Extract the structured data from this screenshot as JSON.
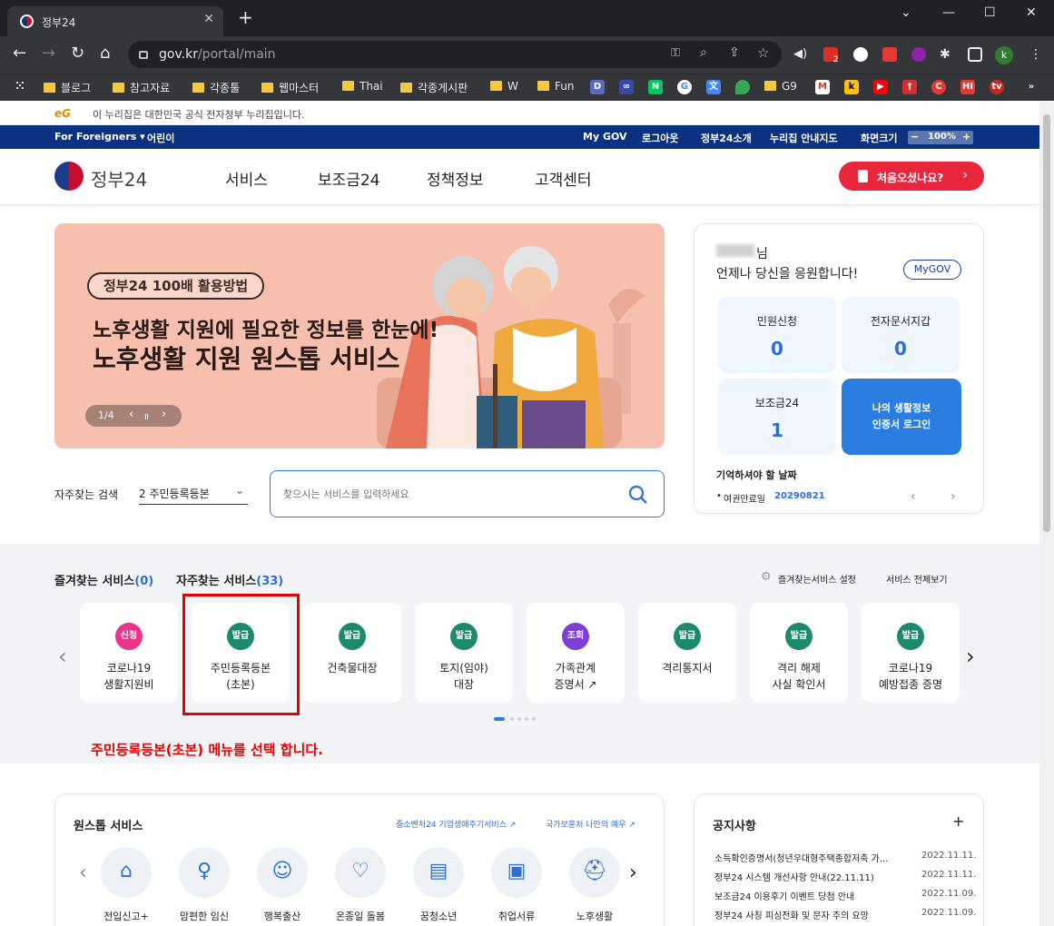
{
  "browser": {
    "tab_title": "정부24",
    "url_host": "gov.kr",
    "url_path": "/portal/main",
    "profile_initial": "k",
    "bookmarks": [
      "블로그",
      "참고자료",
      "각종툴",
      "웹마스터",
      "Thai",
      "각종게시판",
      "W",
      "Fun",
      "G9"
    ],
    "ext_badge": "2"
  },
  "notice_bar": {
    "logo": "eG",
    "text": "이 누리집은 대한민국 공식 전자정부 누리집입니다."
  },
  "gnb": {
    "for_foreigners": "For Foreigners ▾",
    "kids": "어린이",
    "mygov": "My GOV",
    "logout": "로그아웃",
    "about": "정부24소개",
    "sitemap": "누리집 안내지도",
    "screen_size": "화면크기",
    "zoom": "100%"
  },
  "header": {
    "logo": "정부24",
    "menu": [
      "서비스",
      "보조금24",
      "정책정보",
      "고객센터"
    ],
    "first_visit": "처음오셨나요?"
  },
  "banner": {
    "tag": "정부24 100배 활용방법",
    "line1": "노후생활 지원에 필요한 정보를 한눈에!",
    "line2": "노후생활 지원 원스톱 서비스",
    "pager": "1/4"
  },
  "user": {
    "suffix": "님",
    "greeting": "언제나 당신을 응원합니다!",
    "mygov_btn": "MyGOV",
    "tiles": [
      {
        "label": "민원신청",
        "value": "0"
      },
      {
        "label": "전자문서지갑",
        "value": "0"
      },
      {
        "label": "보조금24",
        "value": "1"
      }
    ],
    "login_tile": "나의 생활정보\n인증서 로그인",
    "remember_title": "기억하셔야 할 날짜",
    "remember_item": "여권만료일",
    "remember_date": "20290821"
  },
  "search": {
    "label": "자주찾는 검색",
    "selected": "2 주민등록등본",
    "placeholder": "찾으시는 서비스를 입력하세요"
  },
  "services": {
    "fav_title": "즐겨찾는 서비스",
    "fav_count": "(0)",
    "freq_title": "자주찾는 서비스",
    "freq_count": "(33)",
    "settings": "즐겨찾는서비스 설정",
    "view_all": "서비스 전체보기",
    "cards": [
      {
        "badge": "신청",
        "color": "#e8348b",
        "name": "코로나19\n생활지원비"
      },
      {
        "badge": "발급",
        "color": "#1d8a6e",
        "name": "주민등록등본\n(초본)"
      },
      {
        "badge": "발급",
        "color": "#1d8a6e",
        "name": "건축물대장"
      },
      {
        "badge": "발급",
        "color": "#1d8a6e",
        "name": "토지(임야)\n대장"
      },
      {
        "badge": "조회",
        "color": "#7b3fd6",
        "name": "가족관계\n증명서 ↗"
      },
      {
        "badge": "발급",
        "color": "#1d8a6e",
        "name": "격리통지서"
      },
      {
        "badge": "발급",
        "color": "#1d8a6e",
        "name": "격리 해제\n사실 확인서"
      },
      {
        "badge": "발급",
        "color": "#1d8a6e",
        "name": "코로나19\n예방접종 증명"
      }
    ],
    "annotation": "주민등록등본(초본) 메뉴를 선택 합니다."
  },
  "onestop": {
    "title": "원스톱 서비스",
    "link1": "중소벤처24 기업생애주기서비스 ↗",
    "link2": "국가보훈처 나만의 예우 ↗",
    "items": [
      "전입신고+",
      "맘편한 임신",
      "행복출산",
      "온종일 돌봄",
      "꿈청소년",
      "취업서류",
      "노후생활"
    ]
  },
  "notices": {
    "title": "공지사항",
    "more": "+",
    "rows": [
      {
        "t": "소득확인증명서(청년우대형주택종합저축 가...",
        "d": "2022.11.11."
      },
      {
        "t": "정부24 시스템 개선사항 안내(22.11.11)",
        "d": "2022.11.11."
      },
      {
        "t": "보조금24 이용후기 이벤트 당첨 안내",
        "d": "2022.11.09."
      },
      {
        "t": "정부24 사칭 피싱전화 및 문자 주의 요망",
        "d": "2022.11.09."
      }
    ]
  }
}
